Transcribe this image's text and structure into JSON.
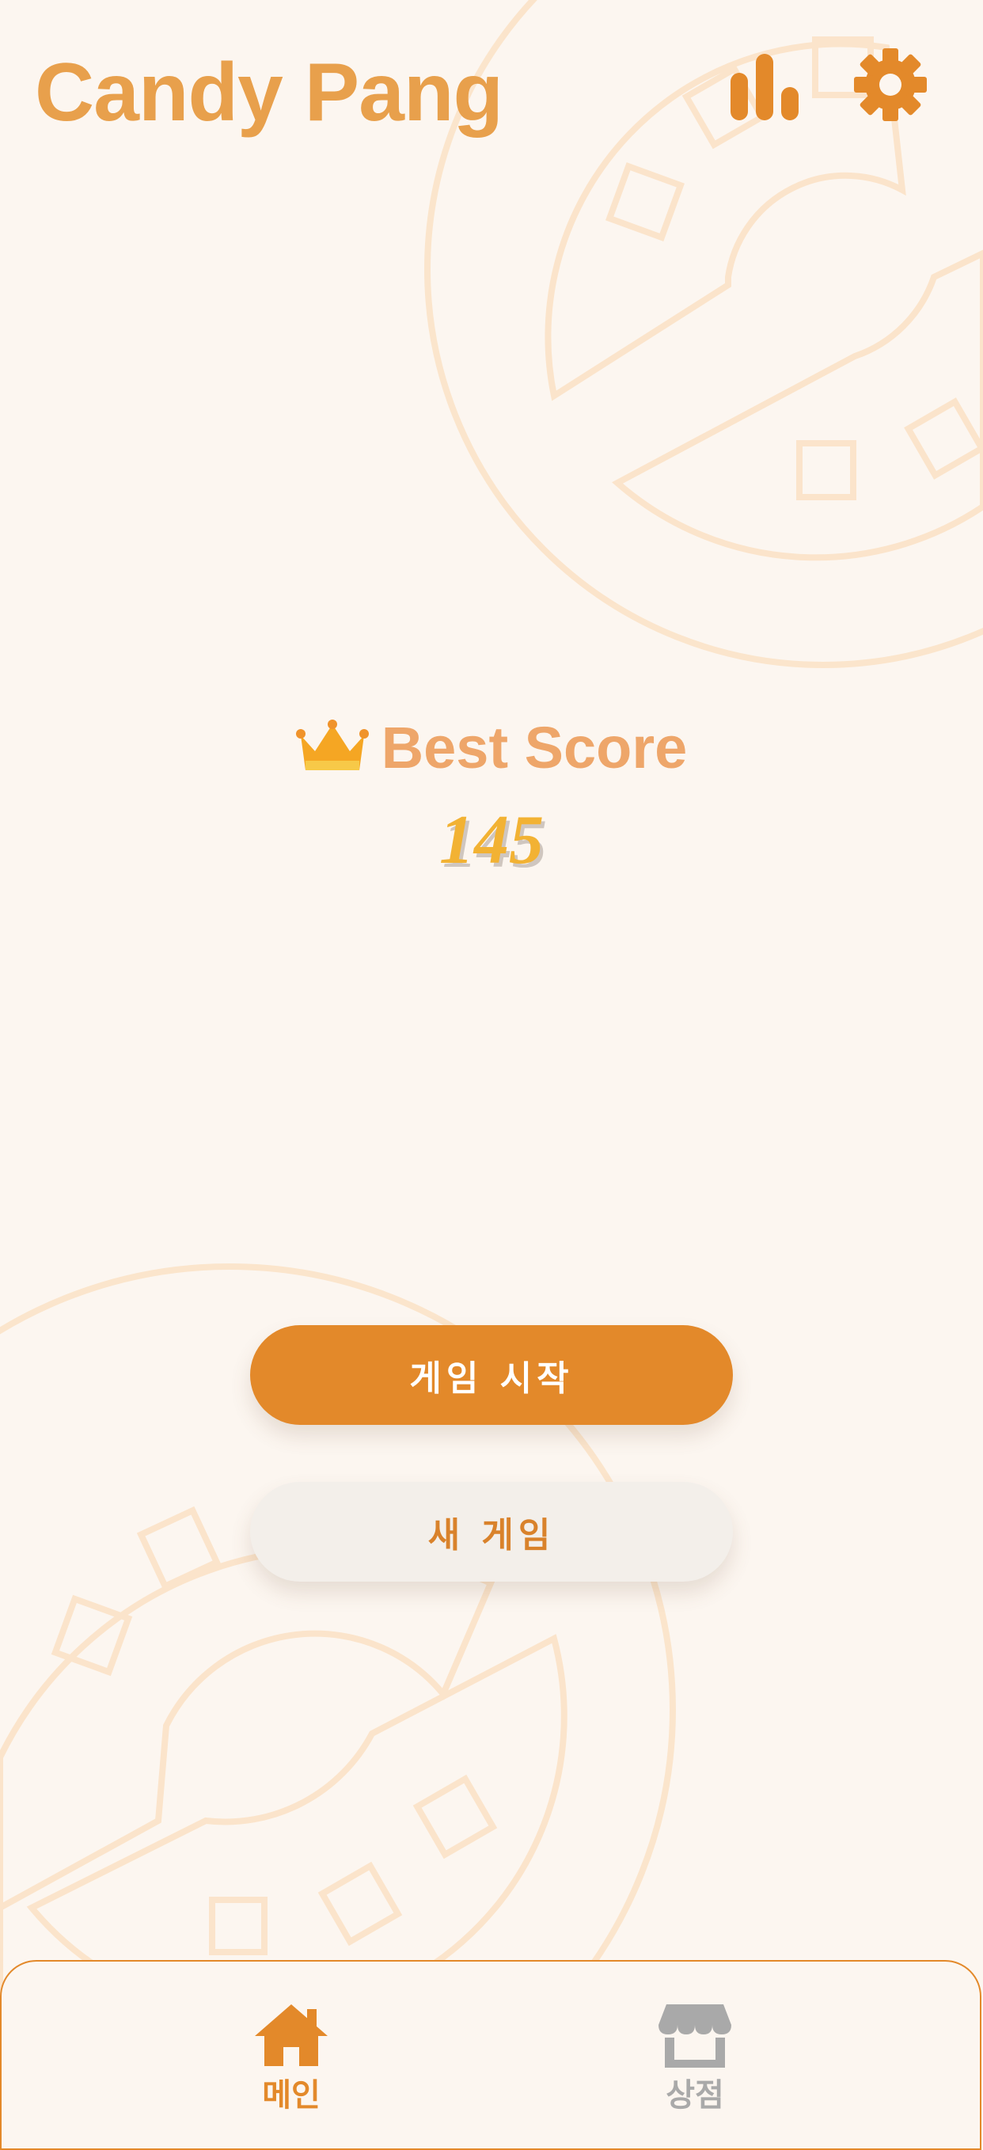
{
  "app": {
    "title": "Candy Pang"
  },
  "header": {
    "stats_icon": "bar-chart-icon",
    "settings_icon": "gear-icon"
  },
  "score": {
    "icon": "crown-icon",
    "label": "Best Score",
    "value": "145"
  },
  "actions": {
    "start_label": "게임 시작",
    "new_game_label": "새 게임"
  },
  "bottom_nav": {
    "items": [
      {
        "label": "메인",
        "icon": "home-icon",
        "active": true
      },
      {
        "label": "상점",
        "icon": "store-icon",
        "active": false
      }
    ]
  },
  "colors": {
    "accent": "#e3892a",
    "title": "#e8a04c",
    "score_label": "#eea66a",
    "score_value": "#f2b233",
    "background": "#fcf6f0",
    "inactive": "#a9a9a9"
  }
}
